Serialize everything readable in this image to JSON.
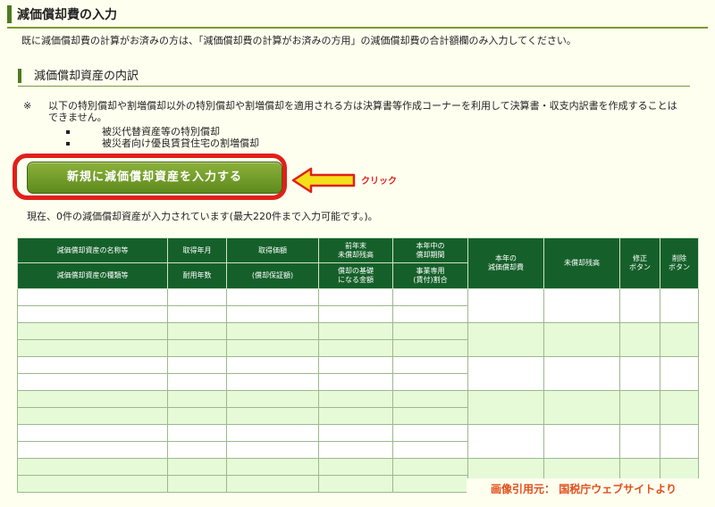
{
  "section": {
    "title": "減価償却費の入力"
  },
  "intro": {
    "text": "既に減価償却費の計算がお済みの方は、「減価償却費の計算がお済みの方用」の減価償却費の合計額欄のみ入力してください。"
  },
  "subsection": {
    "title": "減価償却資産の内訳"
  },
  "note": {
    "mark": "※",
    "text": "以下の特別償却や割増償却以外の特別償却や割増償却を適用される方は決算書等作成コーナーを利用して決算書・収支内訳書を作成することはできません。",
    "items": [
      "被災代替資産等の特別償却",
      "被災者向け優良賃貸住宅の割増償却"
    ]
  },
  "new_button": {
    "label": "新規に減価償却資産を入力する"
  },
  "annotation": {
    "click": "クリック"
  },
  "status": {
    "text": "現在、0件の減価償却資産が入力されています(最大220件まで入力可能です。)。"
  },
  "table": {
    "headers": {
      "name_top": "減価償却資産の名称等",
      "name_bottom": "減価償却資産の種類等",
      "acq_date": "取得年月",
      "useful_life": "耐用年数",
      "acq_price": "取得価額",
      "guarantee": "(償却保証額)",
      "prev_year_top": "前年末",
      "prev_year_bottom": "未償却残高",
      "basis_top": "償却の基礎",
      "basis_bottom": "になる金額",
      "period_top": "本年中の",
      "period_bottom": "償却期間",
      "biz_top": "事業専用",
      "biz_bottom": "(賃付)割合",
      "current_top": "本年の",
      "current_bottom": "減価償却費",
      "remaining": "未償却残高",
      "edit_top": "修正",
      "edit_bottom": "ボタン",
      "delete_top": "削除",
      "delete_bottom": "ボタン"
    },
    "row_count": 6
  },
  "credit": {
    "text": "画像引用元： 国税庁ウェブサイトより"
  },
  "colors": {
    "header_green": "#15602a",
    "accent_red": "#e0201a",
    "button_green": "#6e9a28",
    "row_green": "#e6fad8"
  }
}
